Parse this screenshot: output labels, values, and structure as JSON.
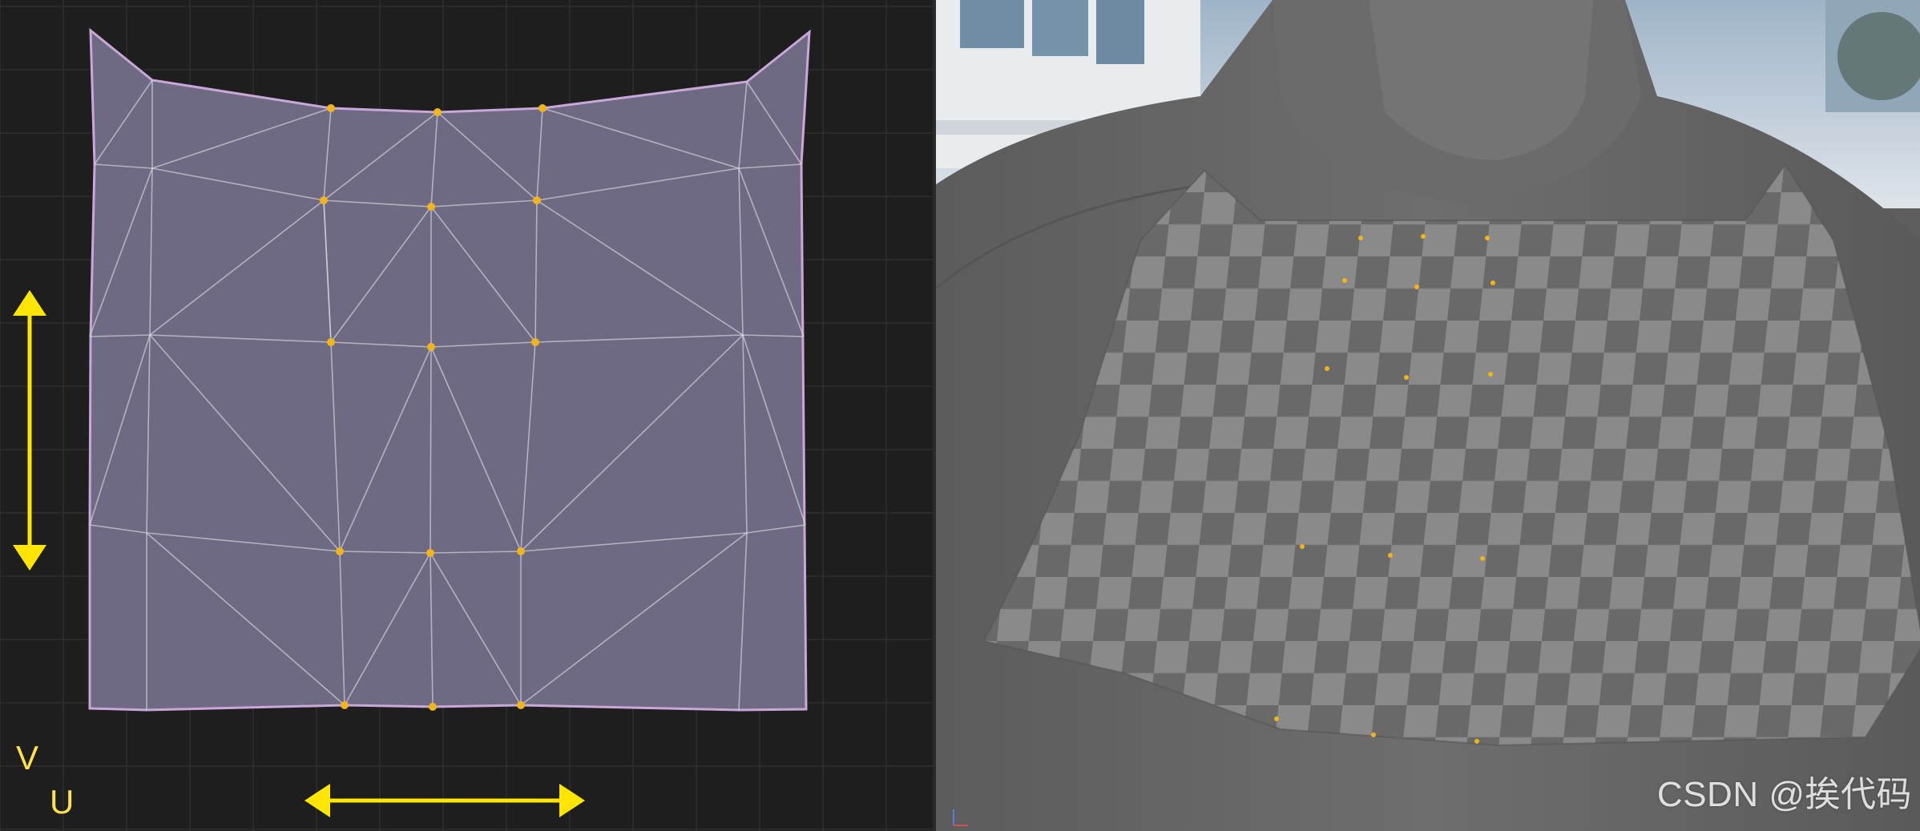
{
  "uv_editor": {
    "axis_v_label": "V",
    "axis_u_label": "U",
    "colors": {
      "background": "#1e1e1e",
      "grid": "#2e2e2e",
      "island_fill": "#6f6a83",
      "island_outline": "#c9a7d8",
      "wire": "#d9d9e0",
      "pin": "#f0b41c",
      "arrow": "#ffe600"
    }
  },
  "viewport": {
    "watermark": "CSDN @挨代码",
    "colors": {
      "mannequin": "#6a6a6a",
      "checker_light": "#8c8c8c",
      "checker_dark": "#6b6b6b",
      "pin": "#f0b41c",
      "sky": "#c6d0db"
    }
  }
}
